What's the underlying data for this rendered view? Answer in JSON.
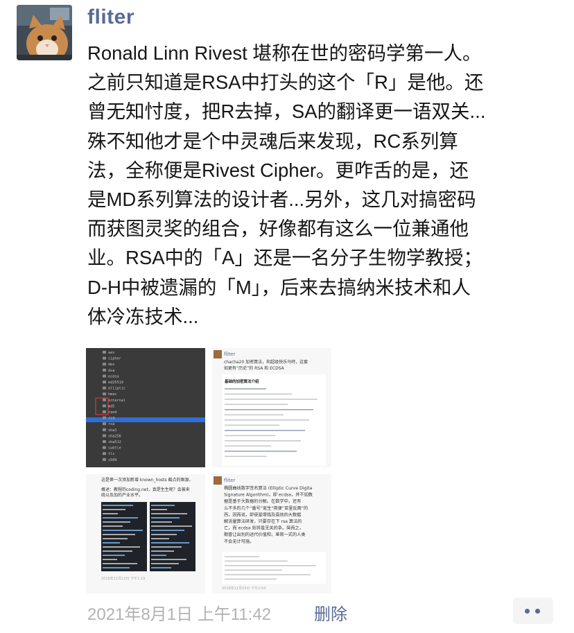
{
  "post": {
    "author": "fliter",
    "text_lines": [
      "Ronald Linn Rivest 堪称在世的密码学第一人。",
      "之前只知道是RSA中打头的这个「R」是他。还",
      "曾无知忖度，把R去掉，SA的翻译更一语双关...",
      "殊不知他才是个中灵魂后来发现，RC系列算",
      "法，全称便是Rivest Cipher。更咋舌的是，还",
      "是MD系列算法的设计者...另外，这几对搞密码",
      "而获图灵奖的组合，好像都有这么一位兼通他",
      "业。RSA中的「A」还是一名分子生物学教授；",
      "D-H中被遗漏的「M」，后来去搞纳米技术和人",
      "体冷冻技术..."
    ],
    "timestamp": "2021年8月1日 上午11:42",
    "delete_label": "删除"
  },
  "thumbnails": {
    "t1": {
      "folders": [
        "aes",
        "cipher",
        "des",
        "dsa",
        "ecdsa",
        "ed25519",
        "elliptic",
        "hmac",
        "internal",
        "md5",
        "rand",
        "rc4",
        "rsa",
        "sha1",
        "sha256",
        "sha512",
        "subtle",
        "tls",
        "x509"
      ]
    },
    "t2": {
      "author": "fliter",
      "lines": [
        "chacha20 加密算法，和超级快乐马特，这套",
        "如更有“历史”的 RSA 和 ECDSA"
      ],
      "heading": "基础的加密算法介绍"
    },
    "t3": {
      "lines": [
        "这是第一次添加新增 known_hosts 截点的图源，",
        "概述：教程的coding.net，真是生生呢？会被来",
        "统以及加的产业水平。"
      ],
      "timestamp": "2018年12月12日 下午1:19"
    },
    "t4": {
      "author": "fliter",
      "lines": [
        "椭圆曲线数字签名算法 (Elliptic Curve Digita",
        "Signature Algorithm)，即 ecdsa，并不如数",
        "据是基于大数据的分解。在数学中，还有",
        "么不多的几个“番号”诞生“简便”亚里反面“的",
        "西，因而说，即使是增强及高效的大数据",
        "解流量算法研发，只要存在下 rsa 算法的",
        "亡，而 ecdsa 则将是无关的争。简而之，",
        "期冒让出别的运代价值和，差简一式的人类",
        "不会无计可施。"
      ],
      "timestamp": "2018年11月15日 下午2:54"
    }
  },
  "colors": {
    "author": "#576b95",
    "text": "#161616",
    "timestamp": "#b2b2b2",
    "link": "#576b95",
    "highlight_bar": "#2f6fd6",
    "red_box": "#d23b3b"
  }
}
